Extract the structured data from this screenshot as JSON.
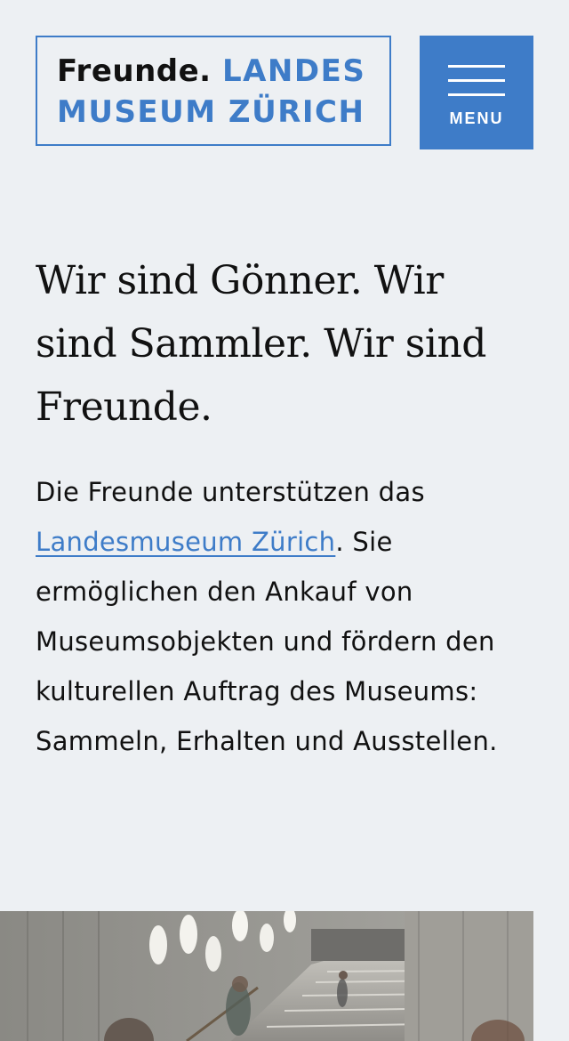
{
  "header": {
    "logo": {
      "line1_dark": "Freunde.",
      "line1_blue": "LANDES",
      "line2": "MUSEUM ZÜRICH"
    },
    "menu_label": "MENU"
  },
  "main": {
    "headline": "Wir sind Gönner. Wir sind Sammler. Wir sind Freunde.",
    "intro": {
      "before_link": "Die Freunde unterstützen das ",
      "link_text": "Landesmuseum Zürich",
      "after_link": ". Sie ermöglichen den Ankauf von Museumsobjekten und fördern den kulturellen Auftrag des Museums: Sammeln, Erhalten und Ausstellen."
    }
  },
  "colors": {
    "accent": "#3e7cc8",
    "background": "#edf0f3",
    "text": "#111111"
  },
  "icons": {
    "menu": "hamburger-icon"
  }
}
